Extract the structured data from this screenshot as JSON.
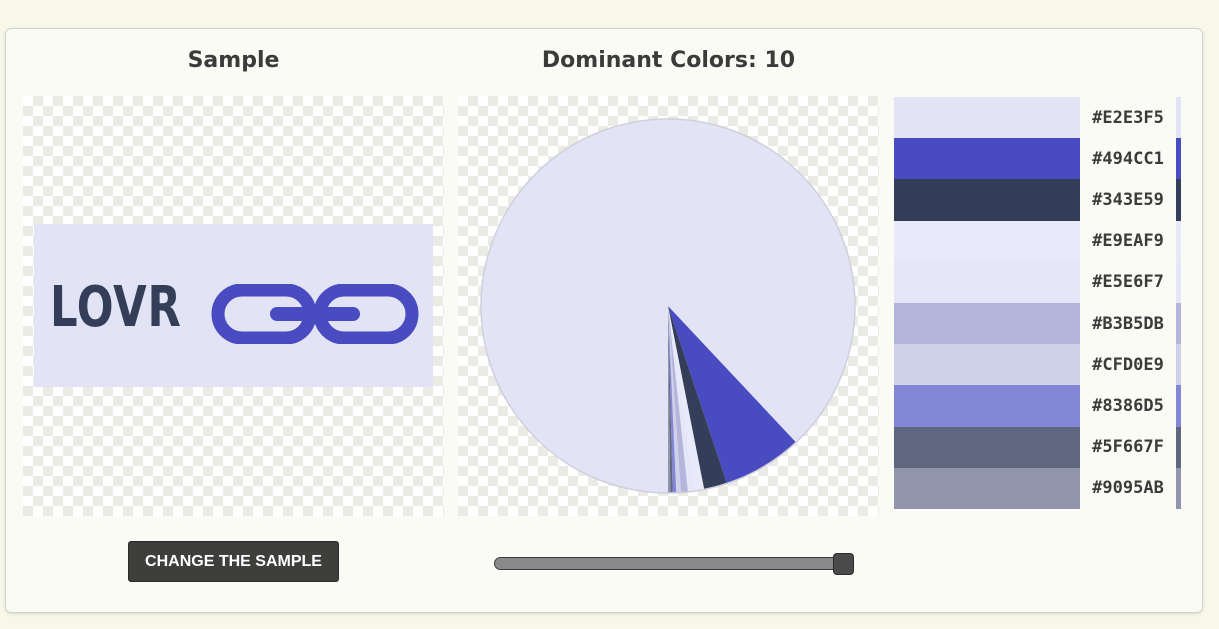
{
  "sample": {
    "heading": "Sample",
    "logo_text": "LOVR",
    "change_button_label": "CHANGE THE SAMPLE"
  },
  "dominant": {
    "heading_prefix": "Dominant Colors:",
    "count": "10",
    "slider_value_fraction": 1.0
  },
  "colors": [
    {
      "hex": "#E2E3F5",
      "color": "#e2e3f5",
      "share": 0.88
    },
    {
      "hex": "#494CC1",
      "color": "#494cc1",
      "share": 0.069
    },
    {
      "hex": "#343E59",
      "color": "#343e59",
      "share": 0.02
    },
    {
      "hex": "#E9EAF9",
      "color": "#e9eaf9",
      "share": 0.008
    },
    {
      "hex": "#E5E6F7",
      "color": "#e5e6f7",
      "share": 0.006
    },
    {
      "hex": "#B3B5DB",
      "color": "#b3b5db",
      "share": 0.006
    },
    {
      "hex": "#CFD0E9",
      "color": "#cfd0e9",
      "share": 0.004
    },
    {
      "hex": "#8386D5",
      "color": "#8386d5",
      "share": 0.003
    },
    {
      "hex": "#5F667F",
      "color": "#5f667f",
      "share": 0.002
    },
    {
      "hex": "#9095AB",
      "color": "#9095ab",
      "share": 0.002
    }
  ]
}
